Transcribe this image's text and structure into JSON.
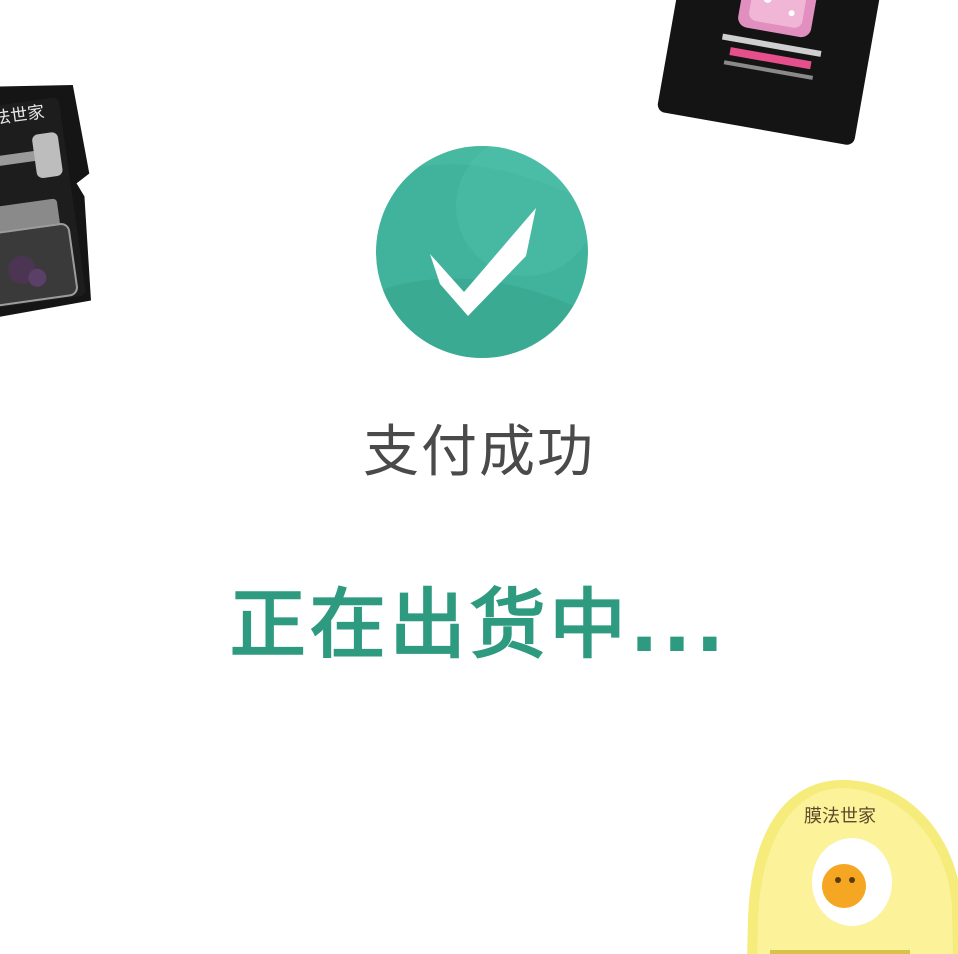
{
  "status": {
    "title": "支付成功",
    "shipping": "正在出货中..."
  },
  "brand": {
    "pack_brand_name": "膜法世家"
  },
  "icons": {
    "success": "checkmark-circle-icon"
  },
  "colors": {
    "accent_green": "#2e9a7f",
    "badge_light": "#52c3ab",
    "badge_dark": "#3fae97",
    "title_gray": "#4a4a4a"
  }
}
